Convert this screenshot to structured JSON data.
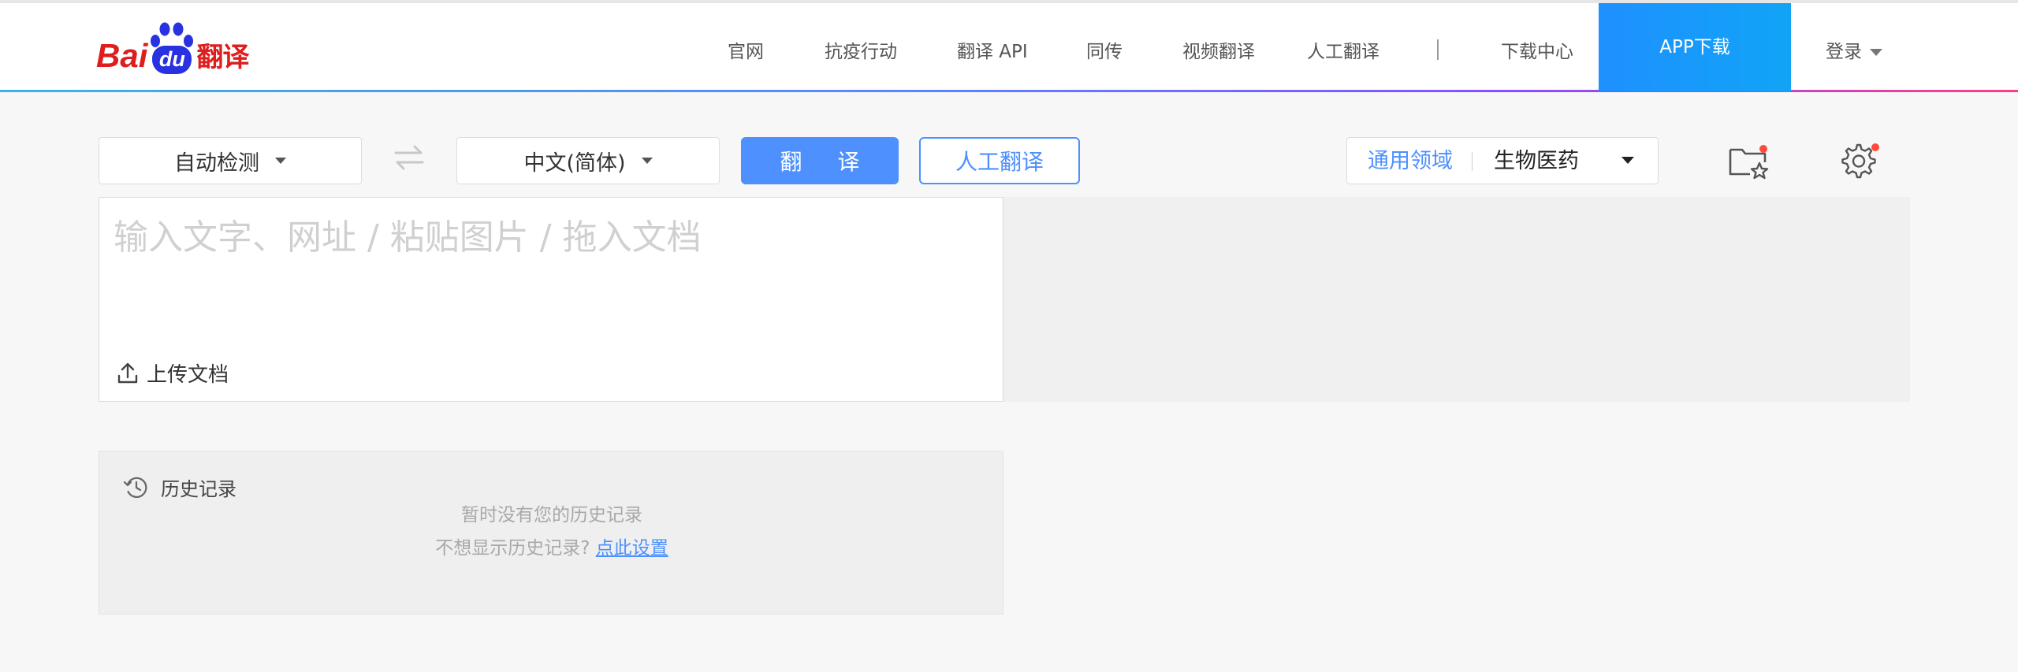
{
  "brand": {
    "logo_bai": "Bai",
    "logo_du": "du",
    "logo_suffix": "翻译",
    "accent_color": "#4d90fe",
    "logo_red": "#de1d1e",
    "logo_blue": "#2932e1"
  },
  "nav": {
    "items": [
      {
        "label": "官网"
      },
      {
        "label": "抗疫行动"
      },
      {
        "label": "翻译 API"
      },
      {
        "label": "同传"
      },
      {
        "label": "视频翻译"
      },
      {
        "label": "人工翻译"
      }
    ],
    "download_center": "下载中心",
    "app_download": "APP下载",
    "login": "登录"
  },
  "toolbar": {
    "source_lang": "自动检测",
    "target_lang": "中文(简体)",
    "translate_label": "翻 译",
    "human_translate_label": "人工翻译",
    "domain_general": "通用领域",
    "domain_selected": "生物医药",
    "swap_icon": "swap-arrows-icon",
    "favorites_icon": "folder-star-icon",
    "settings_icon": "gear-icon"
  },
  "editor": {
    "placeholder": "输入文字、网址 / 粘贴图片 / 拖入文档",
    "value": "",
    "upload_label": "上传文档"
  },
  "history": {
    "title": "历史记录",
    "empty_text": "暂时没有您的历史记录",
    "hint_prefix": "不想显示历史记录?",
    "hint_link": "点此设置"
  }
}
